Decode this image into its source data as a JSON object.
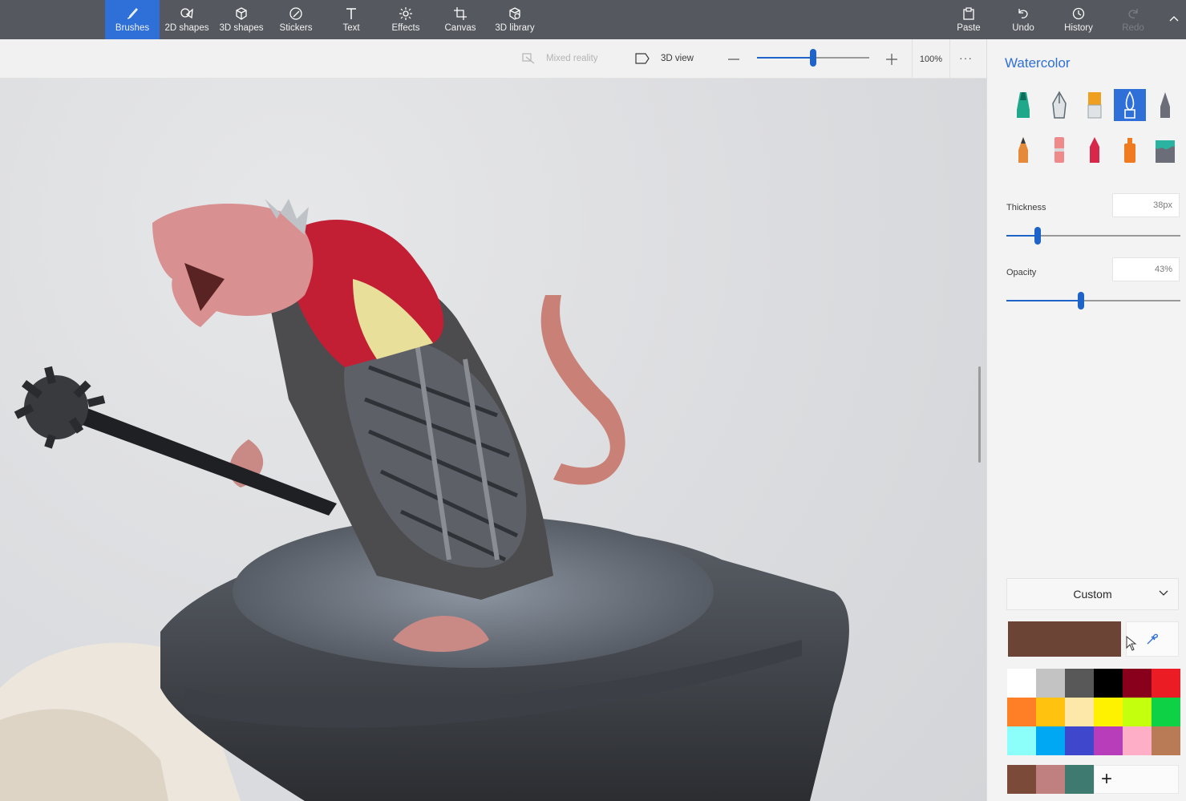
{
  "ribbon": {
    "tabs": [
      {
        "label": "Brushes",
        "icon": "brush-icon",
        "active": true
      },
      {
        "label": "2D shapes",
        "icon": "2d-shapes-icon"
      },
      {
        "label": "3D shapes",
        "icon": "3d-shapes-icon"
      },
      {
        "label": "Stickers",
        "icon": "stickers-icon"
      },
      {
        "label": "Text",
        "icon": "text-icon"
      },
      {
        "label": "Effects",
        "icon": "effects-icon"
      },
      {
        "label": "Canvas",
        "icon": "canvas-icon"
      },
      {
        "label": "3D library",
        "icon": "3d-library-icon"
      }
    ],
    "actions": [
      {
        "label": "Paste",
        "icon": "paste-icon"
      },
      {
        "label": "Undo",
        "icon": "undo-icon"
      },
      {
        "label": "History",
        "icon": "history-icon"
      },
      {
        "label": "Redo",
        "icon": "redo-icon",
        "disabled": true
      }
    ],
    "accent_color": "#2e6fd8"
  },
  "canvas_toolbar": {
    "mixed_reality_label": "Mixed reality",
    "view_3d_label": "3D view",
    "zoom_percent": "100%",
    "zoom_level": 0.5,
    "more_label": "···"
  },
  "panel": {
    "title": "Watercolor",
    "brushes": [
      {
        "name": "marker",
        "color": "#1fa889"
      },
      {
        "name": "calligraphy-pen",
        "color": "#5e6a72"
      },
      {
        "name": "oil-brush",
        "color": "#f0a020"
      },
      {
        "name": "watercolor",
        "color": "#ffffff",
        "selected": true
      },
      {
        "name": "pixel-pen",
        "color": "#6b6e78"
      },
      {
        "name": "pencil",
        "color": "#e58a3a"
      },
      {
        "name": "eraser",
        "color": "#f08a8a"
      },
      {
        "name": "crayon",
        "color": "#d8284a"
      },
      {
        "name": "spray-can",
        "color": "#f07a20"
      },
      {
        "name": "fill",
        "color": "#2ab3a0"
      }
    ],
    "thickness": {
      "label": "Thickness",
      "value": "38px",
      "level": 0.18
    },
    "opacity": {
      "label": "Opacity",
      "value": "43%",
      "level": 0.43
    },
    "palette_dropdown": "Custom",
    "current_color": "#6b4436",
    "palette": [
      "#ffffff",
      "#c3c3c3",
      "#585858",
      "#000000",
      "#88001b",
      "#ec1c24",
      "#ff7f27",
      "#ffc20e",
      "#fde8a9",
      "#fff200",
      "#c4ff0e",
      "#0ed145",
      "#8cfffb",
      "#00a8f3",
      "#3f48cc",
      "#b83dba",
      "#ffaec8",
      "#b97a56"
    ],
    "custom_colors": [
      "#7b4a38",
      "#c08080",
      "#3f7a70"
    ],
    "add_color_label": "+"
  }
}
